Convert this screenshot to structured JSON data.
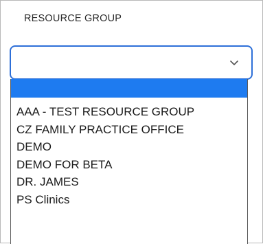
{
  "field": {
    "label": "RESOURCE GROUP",
    "selected_value": ""
  },
  "icons": {
    "chevron": "chevron-down-icon"
  },
  "colors": {
    "accent": "#2d6fd8",
    "highlight": "#1e7bf0"
  },
  "dropdown": {
    "highlighted_index": 0,
    "options": [
      {
        "label": ""
      },
      {
        "label": "AAA - TEST RESOURCE GROUP"
      },
      {
        "label": "CZ FAMILY PRACTICE OFFICE"
      },
      {
        "label": "DEMO"
      },
      {
        "label": "DEMO FOR BETA"
      },
      {
        "label": "DR. JAMES"
      },
      {
        "label": "PS Clinics"
      }
    ]
  }
}
